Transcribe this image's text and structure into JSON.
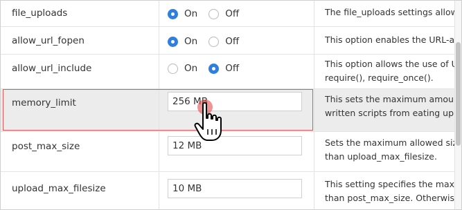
{
  "settings": [
    {
      "name": "file_uploads",
      "control": "radio",
      "options": [
        "On",
        "Off"
      ],
      "selected": "On",
      "description": [
        "The file_uploads settings allow y"
      ]
    },
    {
      "name": "allow_url_fopen",
      "control": "radio",
      "options": [
        "On",
        "Off"
      ],
      "selected": "On",
      "description": [
        "This option enables the URL-awa"
      ]
    },
    {
      "name": "allow_url_include",
      "control": "radio",
      "options": [
        "On",
        "Off"
      ],
      "selected": "Off",
      "description": [
        "This option allows the use of UR",
        "require(), require_once()."
      ]
    },
    {
      "name": "memory_limit",
      "control": "text",
      "value": "256 MB",
      "description": [
        "This sets the maximum amount o",
        "written scripts from eating up al"
      ]
    },
    {
      "name": "post_max_size",
      "control": "text",
      "value": "12 MB",
      "description": [
        "Sets the maximum allowed size o",
        "than upload_max_filesize."
      ]
    },
    {
      "name": "upload_max_filesize",
      "control": "text",
      "value": "10 MB",
      "description": [
        "This setting specifies the maximu",
        "than post_max_size. Otherwise,"
      ]
    }
  ],
  "colors": {
    "accent": "#2f7fe0",
    "focus_outline": "#e05858",
    "row_highlight": "#ececec",
    "click_indicator": "#e03c3c"
  },
  "cursor_icon": "hand-pointer-icon"
}
